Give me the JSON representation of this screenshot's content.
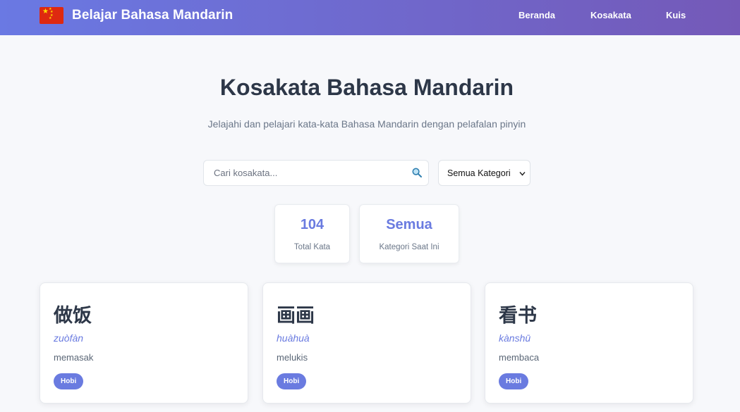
{
  "header": {
    "brand_title": "Belajar Bahasa Mandarin",
    "nav": [
      {
        "label": "Beranda"
      },
      {
        "label": "Kosakata"
      },
      {
        "label": "Kuis"
      }
    ],
    "colors": {
      "gradient_start": "#6a79e3",
      "gradient_end": "#7459b8",
      "flag_red": "#de2910",
      "flag_star": "#ffde00"
    }
  },
  "hero": {
    "title": "Kosakata Bahasa Mandarin",
    "subtitle": "Jelajahi dan pelajari kata-kata Bahasa Mandarin dengan pelafalan pinyin"
  },
  "search": {
    "placeholder": "Cari kosakata...",
    "value": "",
    "icon": "search-icon"
  },
  "category_filter": {
    "selected": "Semua Kategori"
  },
  "stats": [
    {
      "value": "104",
      "label": "Total Kata"
    },
    {
      "value": "Semua",
      "label": "Kategori Saat Ini"
    }
  ],
  "vocab": [
    {
      "hanzi": "做饭",
      "pinyin": "zuòfàn",
      "meaning": "memasak",
      "category": "Hobi"
    },
    {
      "hanzi": "画画",
      "pinyin": "huàhuà",
      "meaning": "melukis",
      "category": "Hobi"
    },
    {
      "hanzi": "看书",
      "pinyin": "kànshū",
      "meaning": "membaca",
      "category": "Hobi"
    }
  ],
  "accent_color": "#6a7be0"
}
